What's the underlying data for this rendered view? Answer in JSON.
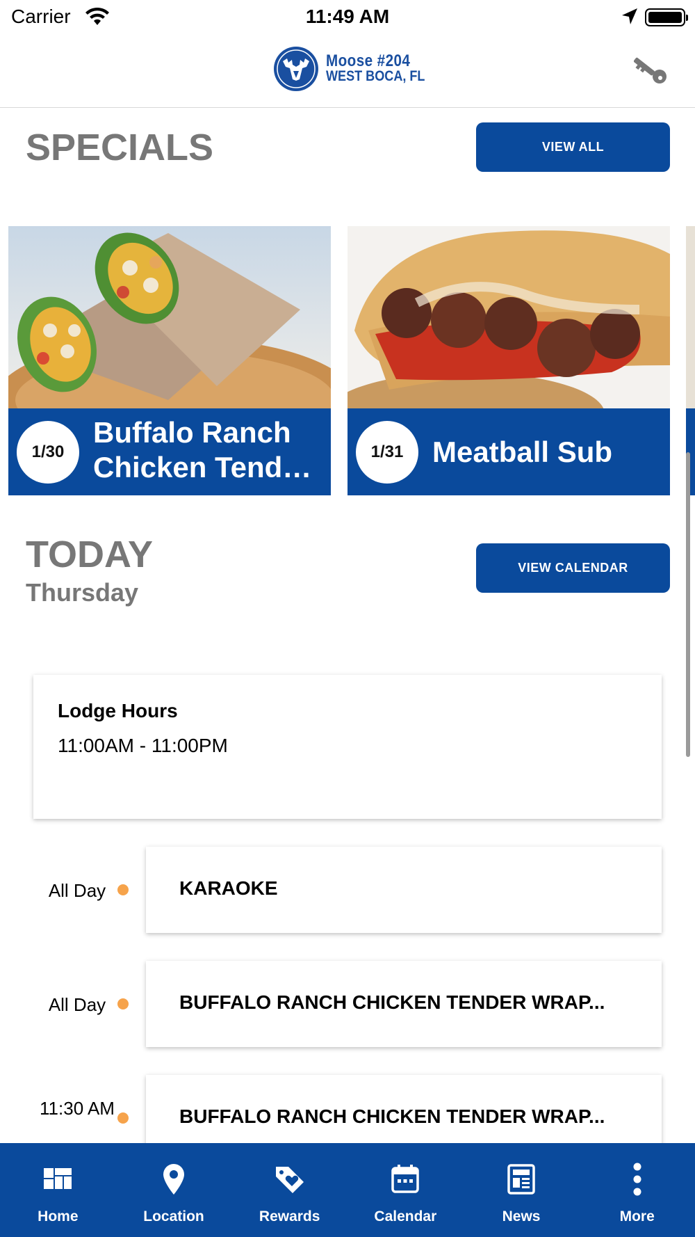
{
  "status_bar": {
    "carrier": "Carrier",
    "time": "11:49 AM"
  },
  "header": {
    "logo_line1": "Moose  #204",
    "logo_line2": "WEST BOCA, FL",
    "icons": [
      "moose-logo-icon",
      "key-icon"
    ]
  },
  "specials": {
    "title": "SPECIALS",
    "view_all_label": "VIEW ALL",
    "items": [
      {
        "date": "1/30",
        "name": "Buffalo Ranch Chicken Tender Wrap"
      },
      {
        "date": "1/31",
        "name": "Meatball Sub"
      }
    ]
  },
  "today": {
    "title": "TODAY",
    "day": "Thursday",
    "view_calendar_label": "VIEW CALENDAR",
    "hours_title": "Lodge Hours",
    "hours_value": "11:00AM - 11:00PM"
  },
  "events": [
    {
      "time": "All Day",
      "title": "KARAOKE"
    },
    {
      "time": "All Day",
      "title": "BUFFALO RANCH CHICKEN TENDER WRAP..."
    },
    {
      "time": "11:30 AM",
      "title": "BUFFALO RANCH CHICKEN TENDER WRAP..."
    }
  ],
  "colors": {
    "primary": "#0a4a9c",
    "event_dot": "#f6a34b",
    "section_title": "#777777"
  },
  "tabs": [
    {
      "label": "Home",
      "icon": "home-grid-icon"
    },
    {
      "label": "Location",
      "icon": "map-pin-icon"
    },
    {
      "label": "Rewards",
      "icon": "tag-heart-icon"
    },
    {
      "label": "Calendar",
      "icon": "calendar-icon"
    },
    {
      "label": "News",
      "icon": "newspaper-icon"
    },
    {
      "label": "More",
      "icon": "more-dots-icon"
    }
  ]
}
